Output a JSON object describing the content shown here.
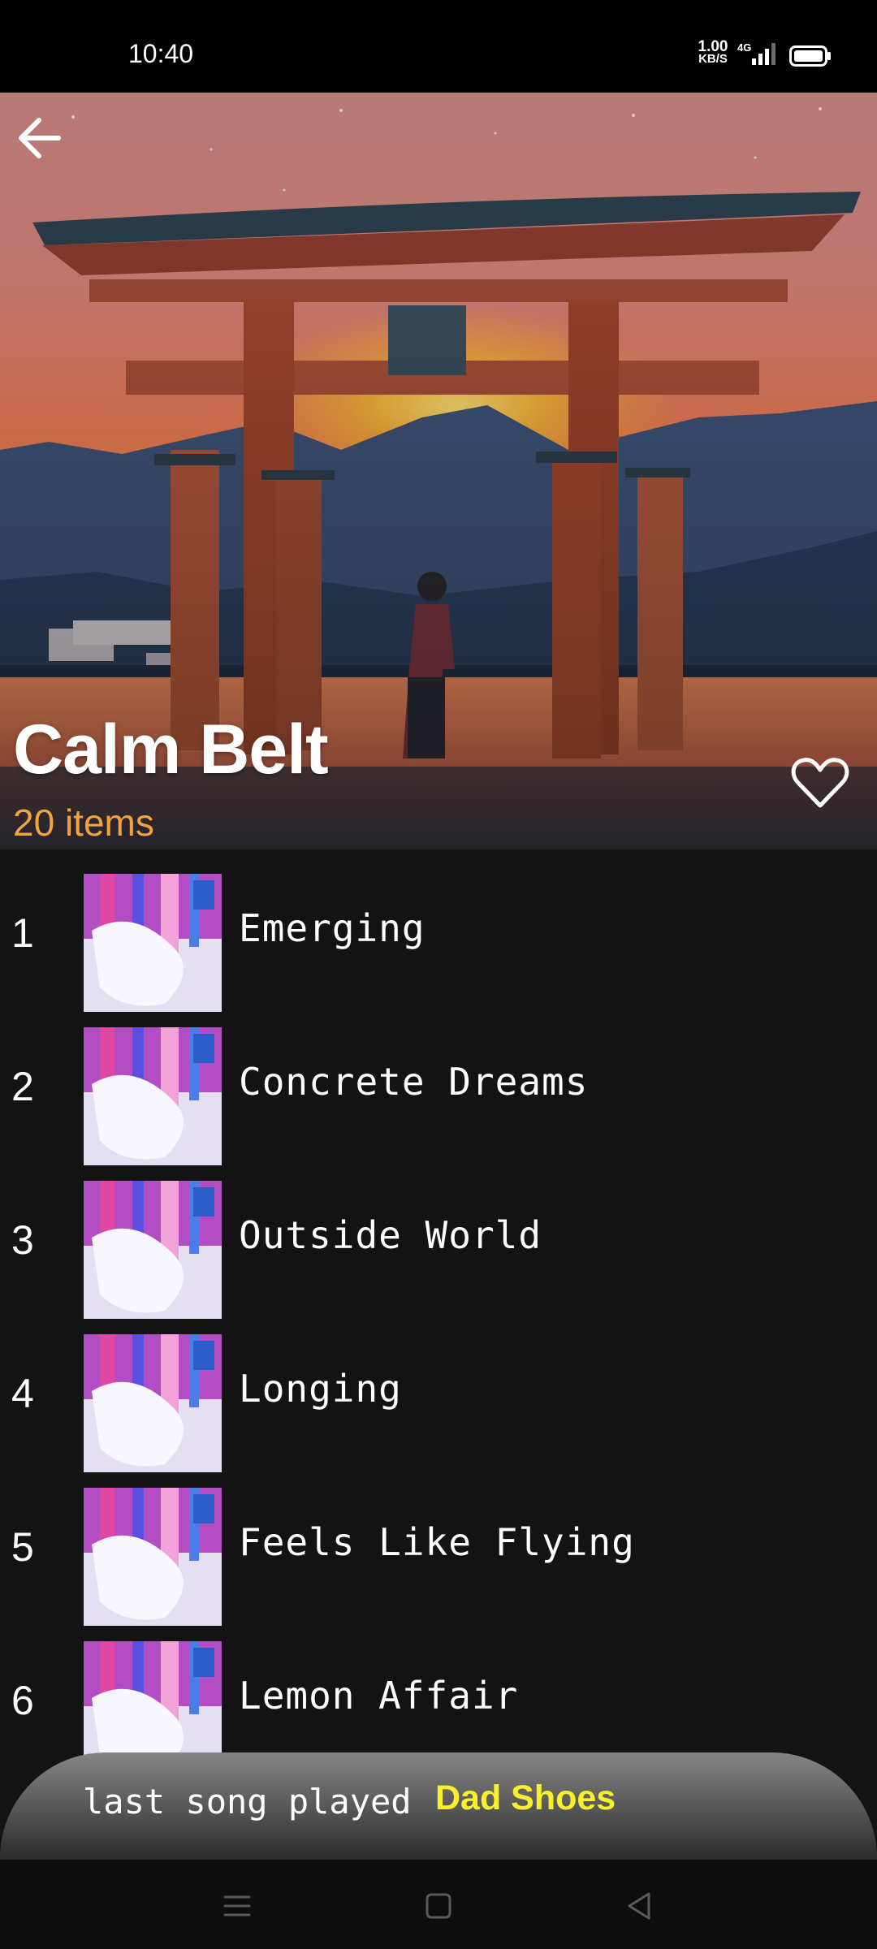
{
  "status": {
    "time": "10:40",
    "net_speed_value": "1.00",
    "net_speed_unit": "KB/S",
    "network_label": "4G"
  },
  "playlist": {
    "title": "Calm Belt",
    "item_count": "20 items"
  },
  "tracks": [
    {
      "number": "1",
      "title": "Emerging"
    },
    {
      "number": "2",
      "title": "Concrete Dreams"
    },
    {
      "number": "3",
      "title": "Outside World"
    },
    {
      "number": "4",
      "title": "Longing"
    },
    {
      "number": "5",
      "title": "Feels Like Flying"
    },
    {
      "number": "6",
      "title": "Lemon Affair"
    }
  ],
  "now_playing": {
    "label": "last song played",
    "song": "Dad Shoes"
  },
  "colors": {
    "accent_count": "#f2a33b",
    "now_playing_song": "#f8f02a",
    "list_background": "#131313"
  },
  "icons": [
    "back-arrow-icon",
    "heart-outline-icon",
    "menu-icon",
    "home-square-icon",
    "back-triangle-icon",
    "battery-icon",
    "signal-icon"
  ]
}
